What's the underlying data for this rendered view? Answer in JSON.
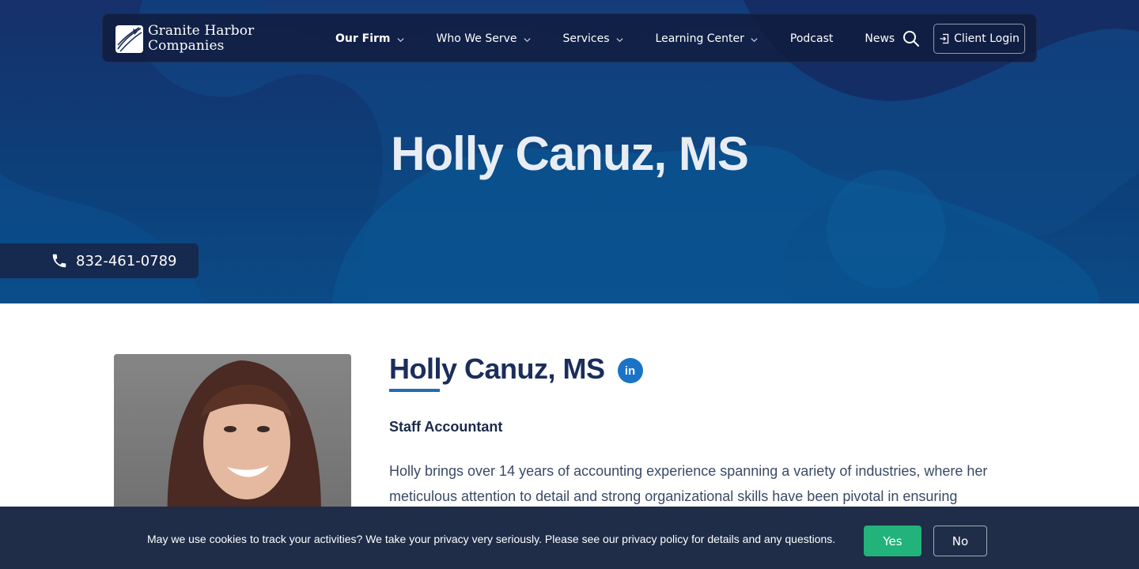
{
  "brand": {
    "name_line1": "Granite Harbor",
    "name_line2": "Companies",
    "logo_icon": "compass-swoosh-icon"
  },
  "nav": {
    "items": [
      {
        "label": "Our Firm",
        "has_dropdown": true
      },
      {
        "label": "Who We Serve",
        "has_dropdown": true
      },
      {
        "label": "Services",
        "has_dropdown": true
      },
      {
        "label": "Learning Center",
        "has_dropdown": true
      },
      {
        "label": "Podcast",
        "has_dropdown": false
      },
      {
        "label": "News",
        "has_dropdown": false
      }
    ],
    "search_icon": "search-icon",
    "login_label": "Client Login",
    "login_icon": "login-icon"
  },
  "hero": {
    "title": "Holly Canuz, MS",
    "phone": "832-461-0789",
    "phone_icon": "phone-icon"
  },
  "profile": {
    "name": "Holly Canuz, MS",
    "linkedin_label": "in",
    "role": "Staff Accountant",
    "bio": "Holly brings over 14 years of accounting experience spanning a variety of industries, where her meticulous attention to detail and strong organizational skills have been pivotal in ensuring"
  },
  "cookie": {
    "message": "May we use cookies to track your activities? We take your privacy very seriously. Please see our privacy policy for details and any questions.",
    "yes_label": "Yes",
    "no_label": "No"
  },
  "colors": {
    "hero_dark": "#16306b",
    "hero_blue": "#0b4a86",
    "accent_blue": "#1f6db3",
    "linkedin_blue": "#1a73c7",
    "yes_green": "#22b37a",
    "cookie_bg": "#1f2d48",
    "name_color": "#1b2d5b"
  }
}
